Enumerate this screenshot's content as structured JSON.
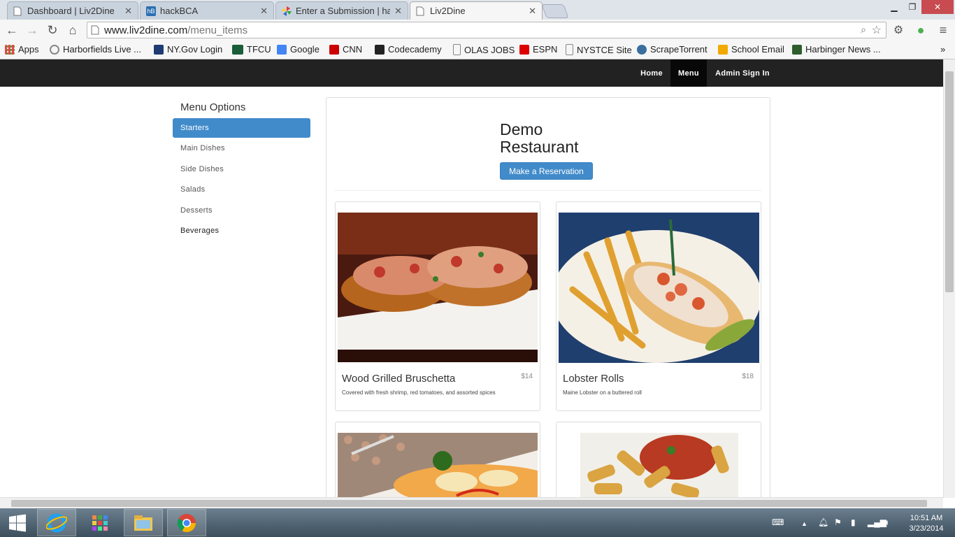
{
  "browser": {
    "tabs": [
      {
        "title": "Dashboard | Liv2Dine"
      },
      {
        "title": "hackBCA"
      },
      {
        "title": "Enter a Submission | ha"
      },
      {
        "title": "Liv2Dine"
      }
    ],
    "url_host": "www.liv2dine.com",
    "url_path": "/menu_items",
    "bookmarks": [
      "Apps",
      "Harborfields Live ...",
      "NY.Gov Login",
      "TFCU",
      "Google",
      "CNN",
      "Codecademy",
      "OLAS JOBS",
      "ESPN",
      "NYSTCE Site",
      "ScrapeTorrent",
      "School Email",
      "Harbinger News ..."
    ]
  },
  "site_nav": {
    "items": [
      "Home",
      "Menu",
      "Admin Sign In"
    ]
  },
  "sidebar": {
    "title": "Menu Options",
    "items": [
      "Starters",
      "Main Dishes",
      "Side Dishes",
      "Salads",
      "Desserts",
      "Beverages"
    ]
  },
  "main": {
    "restaurant_name": "Demo Restaurant",
    "reservation_button": "Make a Reservation",
    "menu_items": [
      {
        "name": "Wood Grilled Bruschetta",
        "price": "$14",
        "description": "Covered with fresh shrimp, red tomatoes, and assorted spices"
      },
      {
        "name": "Lobster Rolls",
        "price": "$18",
        "description": "Maine Lobster on a buttered roll"
      },
      {
        "name": "",
        "price": "",
        "description": ""
      },
      {
        "name": "",
        "price": "",
        "description": ""
      }
    ]
  },
  "taskbar": {
    "time": "10:51 AM",
    "date": "3/23/2014"
  },
  "colors": {
    "primary": "#428bca",
    "navbar": "#222222"
  }
}
